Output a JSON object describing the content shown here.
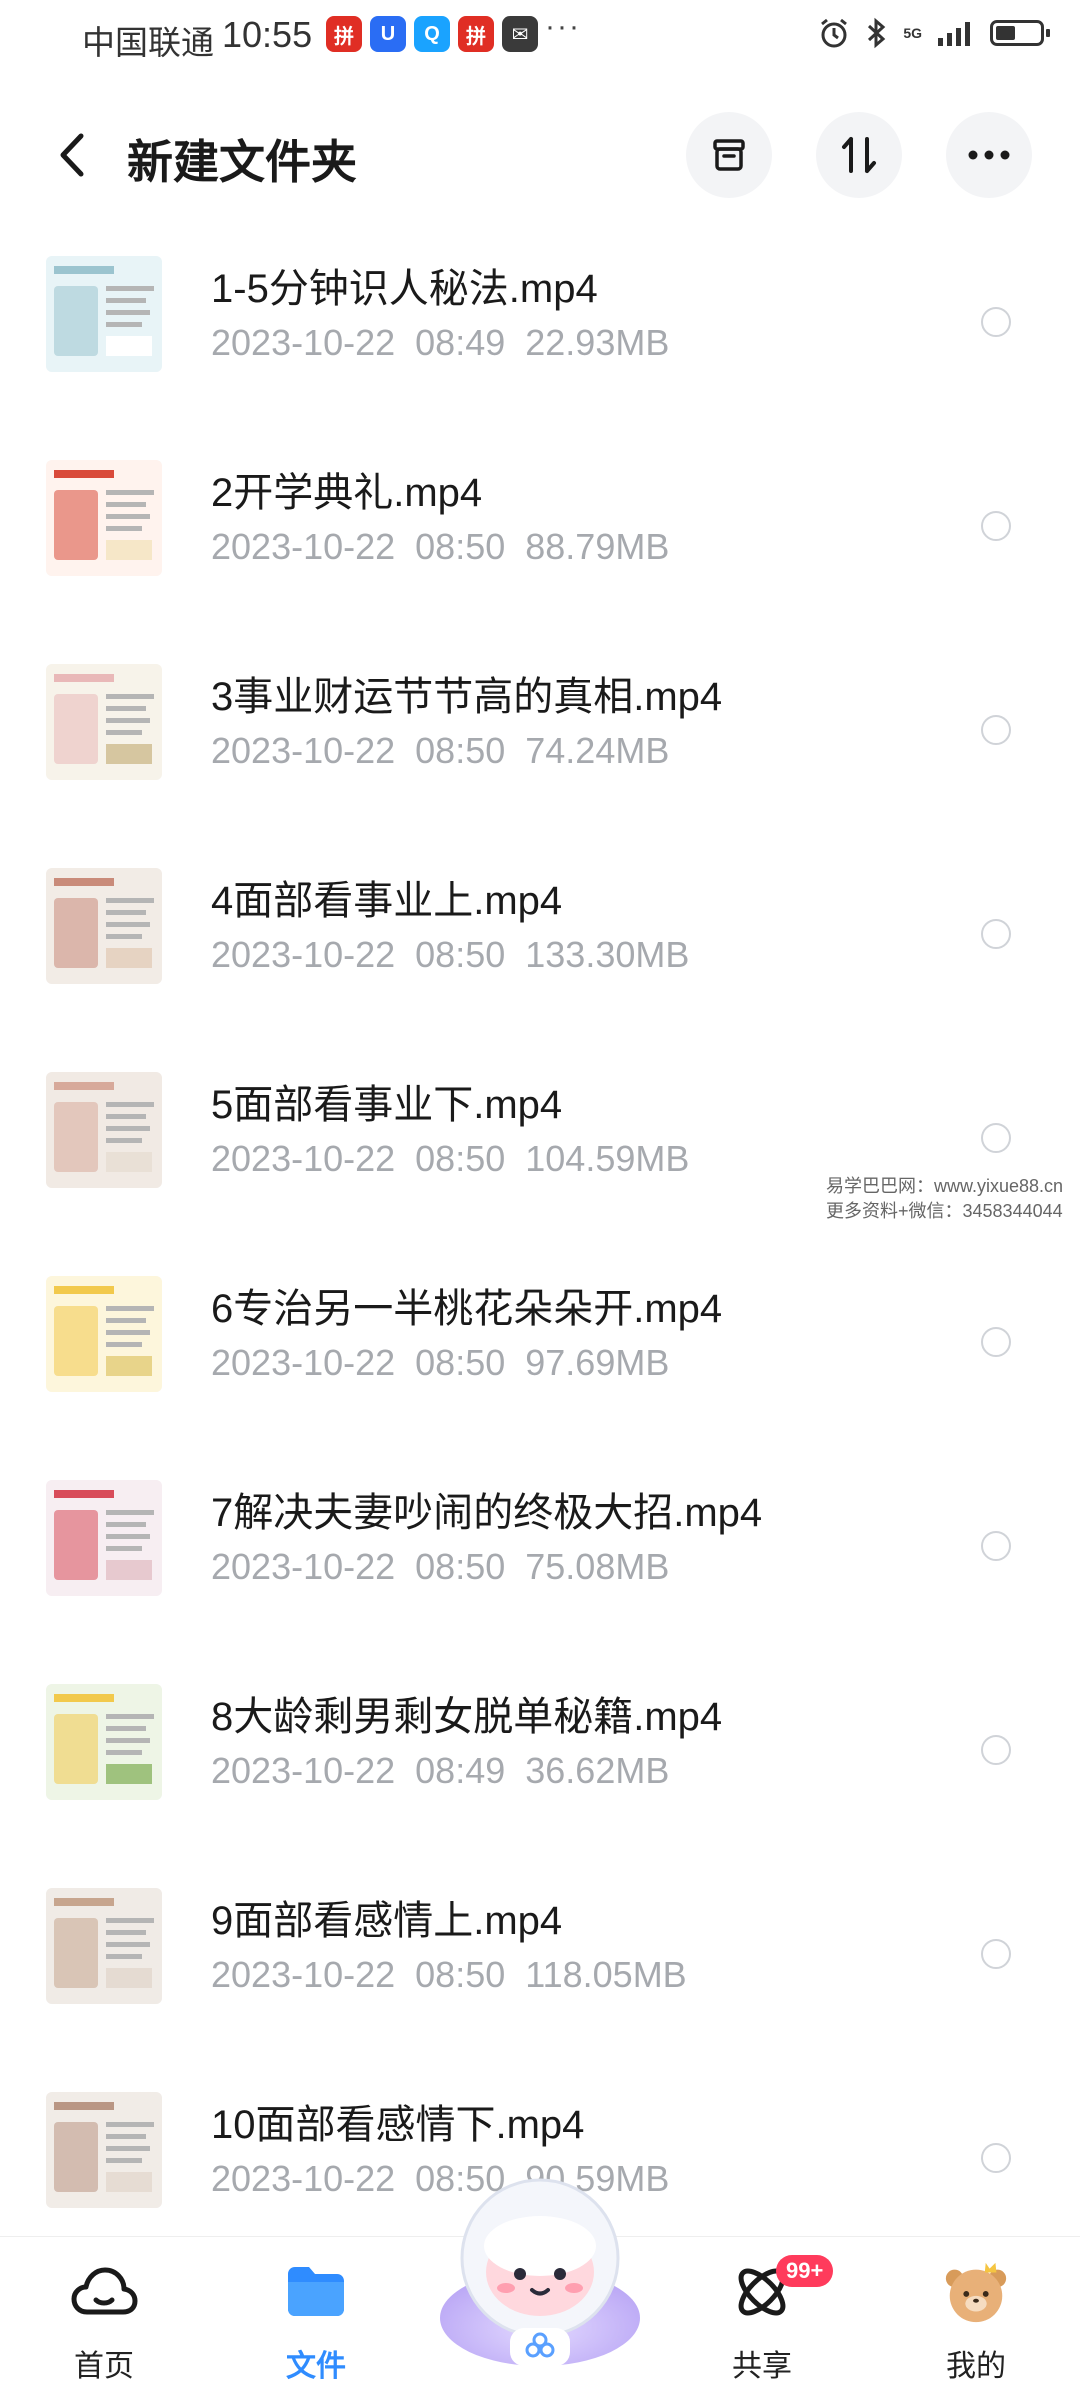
{
  "status_bar": {
    "carrier": "中国联通",
    "time": "10:55",
    "apps": [
      {
        "icon": "pinduoduo-icon",
        "color": "#e02e24"
      },
      {
        "icon": "app-blue-icon",
        "color": "#2a6df4"
      },
      {
        "icon": "search-app-icon",
        "color": "#1aa3ff"
      },
      {
        "icon": "pinduoduo-icon",
        "color": "#e02e24"
      },
      {
        "icon": "app-dark-icon",
        "color": "#3a3a3a"
      }
    ],
    "more": "···",
    "network": "5G"
  },
  "header": {
    "title": "新建文件夹"
  },
  "files": [
    {
      "name": "1-5分钟识人秘法.mp4",
      "date": "2023-10-22",
      "time": "08:49",
      "size": "22.93MB"
    },
    {
      "name": "2开学典礼.mp4",
      "date": "2023-10-22",
      "time": "08:50",
      "size": "88.79MB"
    },
    {
      "name": "3事业财运节节高的真相.mp4",
      "date": "2023-10-22",
      "time": "08:50",
      "size": "74.24MB"
    },
    {
      "name": "4面部看事业上.mp4",
      "date": "2023-10-22",
      "time": "08:50",
      "size": "133.30MB"
    },
    {
      "name": "5面部看事业下.mp4",
      "date": "2023-10-22",
      "time": "08:50",
      "size": "104.59MB"
    },
    {
      "name": "6专治另一半桃花朵朵开.mp4",
      "date": "2023-10-22",
      "time": "08:50",
      "size": "97.69MB"
    },
    {
      "name": "7解决夫妻吵闹的终极大招.mp4",
      "date": "2023-10-22",
      "time": "08:50",
      "size": "75.08MB"
    },
    {
      "name": "8大龄剩男剩女脱单秘籍.mp4",
      "date": "2023-10-22",
      "time": "08:49",
      "size": "36.62MB"
    },
    {
      "name": "9面部看感情上.mp4",
      "date": "2023-10-22",
      "time": "08:50",
      "size": "118.05MB"
    },
    {
      "name": "10面部看感情下.mp4",
      "date": "2023-10-22",
      "time": "08:50",
      "size": "90.59MB"
    }
  ],
  "watermark": {
    "line1": "易学巴巴网：www.yixue88.cn",
    "line2": "更多资料+微信：3458344044"
  },
  "nav": {
    "home": "首页",
    "files": "文件",
    "share": "共享",
    "share_badge": "99+",
    "mine": "我的"
  },
  "colors": {
    "accent": "#2f8cff",
    "badge": "#ff3b5c",
    "meta_text": "#a6a9ae"
  }
}
